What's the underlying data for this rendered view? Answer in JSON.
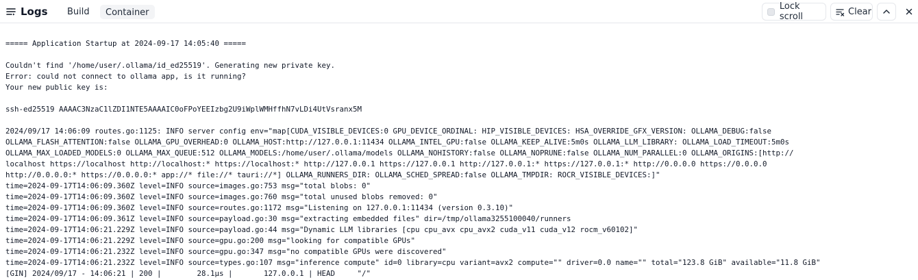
{
  "header": {
    "title": "Logs",
    "tabs": [
      {
        "label": "Build"
      },
      {
        "label": "Container"
      }
    ],
    "lock_scroll_label": "Lock scroll",
    "clear_label": "Clear"
  },
  "icons": {
    "logs": "list-lines-icon",
    "lock": "checkbox-icon",
    "clear": "clear-list-icon",
    "up": "chevron-up-icon",
    "close": "close-icon"
  },
  "colors": {
    "header_border": "#e5e7eb",
    "active_tab_bg": "#f3f4f6",
    "text": "#111827"
  },
  "log": {
    "lines": [
      "===== Application Startup at 2024-09-17 14:05:40 =====",
      "",
      "Couldn't find '/home/user/.ollama/id_ed25519'. Generating new private key.",
      "Error: could not connect to ollama app, is it running?",
      "Your new public key is:",
      "",
      "ssh-ed25519 AAAAC3NzaC1lZDI1NTE5AAAAIC0oFPoYEEIzbg2U9iWplWMHffhN7vLDi4UtVsranx5M",
      "",
      "2024/09/17 14:06:09 routes.go:1125: INFO server config env=\"map[CUDA_VISIBLE_DEVICES:0 GPU_DEVICE_ORDINAL: HIP_VISIBLE_DEVICES: HSA_OVERRIDE_GFX_VERSION: OLLAMA_DEBUG:false",
      "OLLAMA_FLASH_ATTENTION:false OLLAMA_GPU_OVERHEAD:0 OLLAMA_HOST:http://127.0.0.1:11434 OLLAMA_INTEL_GPU:false OLLAMA_KEEP_ALIVE:5m0s OLLAMA_LLM_LIBRARY: OLLAMA_LOAD_TIMEOUT:5m0s",
      "OLLAMA_MAX_LOADED_MODELS:0 OLLAMA_MAX_QUEUE:512 OLLAMA_MODELS:/home/user/.ollama/models OLLAMA_NOHISTORY:false OLLAMA_NOPRUNE:false OLLAMA_NUM_PARALLEL:0 OLLAMA_ORIGINS:[http://",
      "localhost https://localhost http://localhost:* https://localhost:* http://127.0.0.1 https://127.0.0.1 http://127.0.0.1:* https://127.0.0.1:* http://0.0.0.0 https://0.0.0.0",
      "http://0.0.0.0:* https://0.0.0.0:* app://* file://* tauri://*] OLLAMA_RUNNERS_DIR: OLLAMA_SCHED_SPREAD:false OLLAMA_TMPDIR: ROCR_VISIBLE_DEVICES:]\"",
      "time=2024-09-17T14:06:09.360Z level=INFO source=images.go:753 msg=\"total blobs: 0\"",
      "time=2024-09-17T14:06:09.360Z level=INFO source=images.go:760 msg=\"total unused blobs removed: 0\"",
      "time=2024-09-17T14:06:09.360Z level=INFO source=routes.go:1172 msg=\"Listening on 127.0.0.1:11434 (version 0.3.10)\"",
      "time=2024-09-17T14:06:09.361Z level=INFO source=payload.go:30 msg=\"extracting embedded files\" dir=/tmp/ollama3255100040/runners",
      "time=2024-09-17T14:06:21.229Z level=INFO source=payload.go:44 msg=\"Dynamic LLM libraries [cpu cpu_avx cpu_avx2 cuda_v11 cuda_v12 rocm_v60102]\"",
      "time=2024-09-17T14:06:21.229Z level=INFO source=gpu.go:200 msg=\"looking for compatible GPUs\"",
      "time=2024-09-17T14:06:21.232Z level=INFO source=gpu.go:347 msg=\"no compatible GPUs were discovered\"",
      "time=2024-09-17T14:06:21.232Z level=INFO source=types.go:107 msg=\"inference compute\" id=0 library=cpu variant=avx2 compute=\"\" driver=0.0 name=\"\" total=\"123.8 GiB\" available=\"11.8 GiB\"",
      "[GIN] 2024/09/17 - 14:06:21 | 200 |        28.1µs |       127.0.0.1 | HEAD     \"/\""
    ]
  }
}
